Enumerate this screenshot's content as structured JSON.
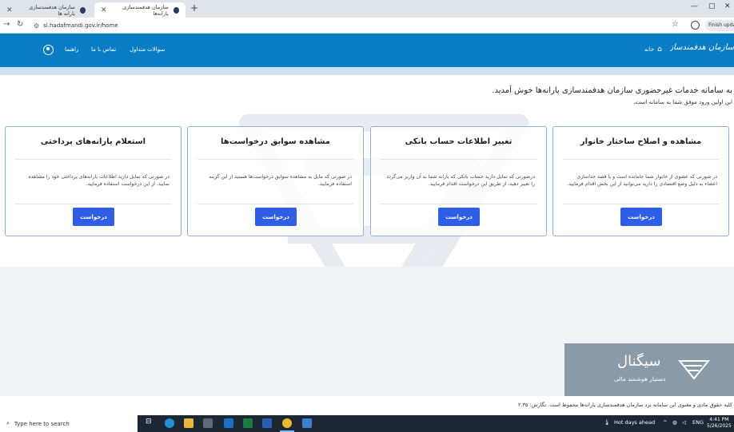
{
  "browser": {
    "tabs": [
      {
        "title": "سازمان هدفمندسازی یارانه ها"
      },
      {
        "title": "سازمان هدفمندسازی یارانه‌ها"
      }
    ],
    "new_tab_icon": "plus-icon",
    "url": "sl.hadafmandi.gov.ir/home",
    "finish_update_label": "Finish update"
  },
  "header": {
    "logo_text": "سازمان هدفمندسازی یارانه‌ها",
    "nav": {
      "home": "خانه",
      "faq": "سوالات متداول",
      "contact": "تماس با ما",
      "help": "راهنما"
    }
  },
  "welcome": {
    "title": "به سامانه خدمات غیرحضوری سازمان هدفمندسازی یارانه‌ها خوش آمدید.",
    "subtitle": "این اولین ورود موفق شما به سامانه است."
  },
  "cards": [
    {
      "title": "مشاهده و اصلاح ساختار خانوار",
      "description": "در صورتی که عضوی از خانوار شما جامانده است و یا قصد جداسازی اعضاء به دلیل وضع اقتصادی را دارید می‌توانید از این بخش اقدام فرمایید.",
      "button": "درخواست"
    },
    {
      "title": "تغییر اطلاعات حساب بانکی",
      "description": "درصورتی که تمایل دارید حساب بانکی که یارانه شما به آن واریز می‌گردد را تغییر دهید، از طریق این درخواست اقدام فرمایید.",
      "button": "درخواست"
    },
    {
      "title": "مشاهده سوابق درخواست‌ها",
      "description": "در صورتی که مایل به مشاهده سوابق درخواست‌ها هستید از این گزینه استفاده فرمایید.",
      "button": "درخواست"
    },
    {
      "title": "استعلام یارانه‌های پرداختی",
      "description": "در صورتی که تمایل دارید اطلاعات یارانه‌های پرداختی خود را مشاهده نمایید، از این درخواست استفاده فرمایید.",
      "button": "درخواست"
    }
  ],
  "promo": {
    "title": "سیگنال",
    "subtitle": "دستیار هوشمند مالی"
  },
  "footer": {
    "text": "کلیه حقوق مادی و معنوی این سامانه نزد سازمان هدفمندسازی یارانه‌ها محفوظ است. نگارش: ۲.۳۵"
  },
  "taskbar": {
    "search_placeholder": "Type here to search",
    "weather": "Hot days ahead",
    "language": "ENG",
    "time": "4:41 PM",
    "date": "5/26/2025"
  },
  "colors": {
    "header_blue": "#0a7cc4",
    "button_blue": "#2f5ee6",
    "card_border": "#8fb2d6"
  }
}
